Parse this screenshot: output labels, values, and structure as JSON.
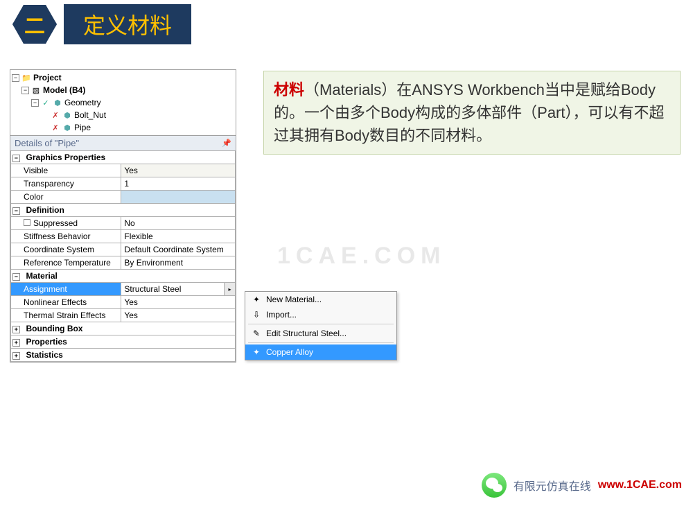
{
  "header": {
    "badge": "二",
    "title": "定义材料"
  },
  "tree": {
    "project": "Project",
    "model": "Model (B4)",
    "geometry": "Geometry",
    "body1": "Bolt_Nut",
    "body2": "Pipe"
  },
  "details": {
    "title_prefix": "Details of \"",
    "title_subject": "Pipe",
    "title_suffix": "\"",
    "groups": {
      "g1": {
        "label": "Graphics Properties",
        "rows": [
          {
            "k": "Visible",
            "v": "Yes"
          },
          {
            "k": "Transparency",
            "v": "1"
          },
          {
            "k": "Color",
            "v": ""
          }
        ]
      },
      "g2": {
        "label": "Definition",
        "rows": [
          {
            "k": "Suppressed",
            "v": "No"
          },
          {
            "k": "Stiffness Behavior",
            "v": "Flexible"
          },
          {
            "k": "Coordinate System",
            "v": "Default Coordinate System"
          },
          {
            "k": "Reference Temperature",
            "v": "By Environment"
          }
        ]
      },
      "g3": {
        "label": "Material",
        "rows": [
          {
            "k": "Assignment",
            "v": "Structural Steel",
            "selected": true,
            "dropdown": true
          },
          {
            "k": "Nonlinear Effects",
            "v": "Yes"
          },
          {
            "k": "Thermal Strain Effects",
            "v": "Yes"
          }
        ]
      },
      "g4": {
        "label": "Bounding Box"
      },
      "g5": {
        "label": "Properties"
      },
      "g6": {
        "label": "Statistics"
      }
    }
  },
  "info": {
    "keyword": "材料",
    "text": "（Materials）在ANSYS Workbench当中是赋给Body的。一个由多个Body构成的多体部件（Part），可以有不超过其拥有Body数目的不同材料。"
  },
  "menu": {
    "items": [
      {
        "label": "New Material...",
        "icon": "✦"
      },
      {
        "label": "Import...",
        "icon": "⇩"
      },
      {
        "label": "Edit Structural Steel...",
        "icon": "✎"
      },
      {
        "label": "Copper Alloy",
        "icon": "✦",
        "selected": true
      }
    ]
  },
  "watermark": "1CAE.COM",
  "footer": {
    "cn": "有限元仿真在线",
    "url": "www.1CAE.com"
  }
}
